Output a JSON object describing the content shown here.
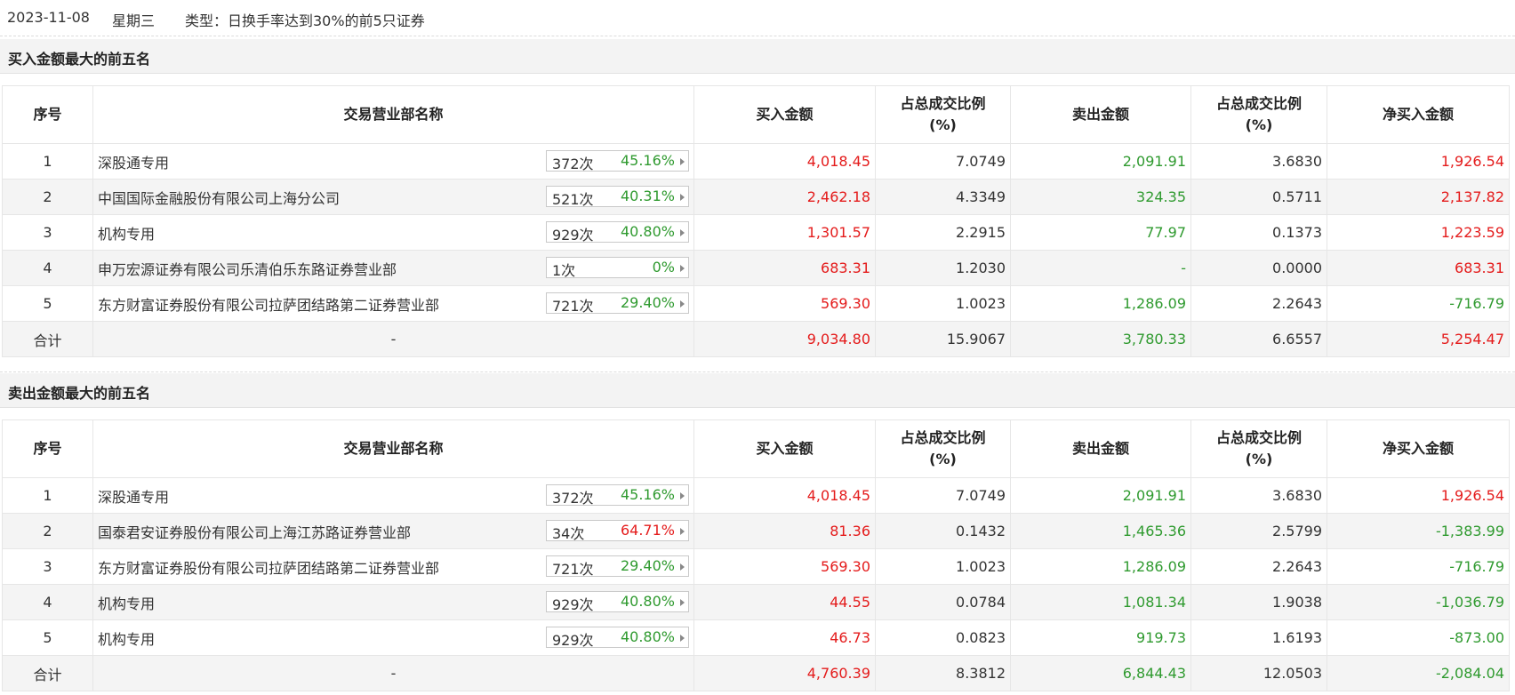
{
  "header": {
    "date": "2023-11-08",
    "weekday": "星期三",
    "type_label": "类型：日换手率达到30%的前5只证券"
  },
  "columns": {
    "seq": "序号",
    "name": "交易营业部名称",
    "buy": "买入金额",
    "buy_ratio_line1": "占总成交比例",
    "buy_ratio_line2": "(%)",
    "sell": "卖出金额",
    "sell_ratio_line1": "占总成交比例",
    "sell_ratio_line2": "(%)",
    "net": "净买入金额"
  },
  "buy_section": {
    "title": "买入金额最大的前五名",
    "rows": [
      {
        "seq": "1",
        "name": "深股通专用",
        "count": "372次",
        "rate": "45.16%",
        "rate_color": "green",
        "buy": "4,018.45",
        "buy_ratio": "7.0749",
        "sell": "2,091.91",
        "sell_ratio": "3.6830",
        "net": "1,926.54",
        "net_color": "red"
      },
      {
        "seq": "2",
        "name": "中国国际金融股份有限公司上海分公司",
        "count": "521次",
        "rate": "40.31%",
        "rate_color": "green",
        "buy": "2,462.18",
        "buy_ratio": "4.3349",
        "sell": "324.35",
        "sell_ratio": "0.5711",
        "net": "2,137.82",
        "net_color": "red"
      },
      {
        "seq": "3",
        "name": "机构专用",
        "count": "929次",
        "rate": "40.80%",
        "rate_color": "green",
        "buy": "1,301.57",
        "buy_ratio": "2.2915",
        "sell": "77.97",
        "sell_ratio": "0.1373",
        "net": "1,223.59",
        "net_color": "red"
      },
      {
        "seq": "4",
        "name": "申万宏源证券有限公司乐清伯乐东路证券营业部",
        "count": "1次",
        "rate": "0%",
        "rate_color": "green",
        "buy": "683.31",
        "buy_ratio": "1.2030",
        "sell": "-",
        "sell_ratio": "0.0000",
        "net": "683.31",
        "net_color": "red"
      },
      {
        "seq": "5",
        "name": "东方财富证券股份有限公司拉萨团结路第二证券营业部",
        "count": "721次",
        "rate": "29.40%",
        "rate_color": "green",
        "buy": "569.30",
        "buy_ratio": "1.0023",
        "sell": "1,286.09",
        "sell_ratio": "2.2643",
        "net": "-716.79",
        "net_color": "green"
      }
    ],
    "total": {
      "label": "合计",
      "name": "-",
      "buy": "9,034.80",
      "buy_ratio": "15.9067",
      "sell": "3,780.33",
      "sell_ratio": "6.6557",
      "net": "5,254.47",
      "net_color": "red"
    }
  },
  "sell_section": {
    "title": "卖出金额最大的前五名",
    "rows": [
      {
        "seq": "1",
        "name": "深股通专用",
        "count": "372次",
        "rate": "45.16%",
        "rate_color": "green",
        "buy": "4,018.45",
        "buy_ratio": "7.0749",
        "sell": "2,091.91",
        "sell_ratio": "3.6830",
        "net": "1,926.54",
        "net_color": "red"
      },
      {
        "seq": "2",
        "name": "国泰君安证券股份有限公司上海江苏路证券营业部",
        "count": "34次",
        "rate": "64.71%",
        "rate_color": "red",
        "buy": "81.36",
        "buy_ratio": "0.1432",
        "sell": "1,465.36",
        "sell_ratio": "2.5799",
        "net": "-1,383.99",
        "net_color": "green"
      },
      {
        "seq": "3",
        "name": "东方财富证券股份有限公司拉萨团结路第二证券营业部",
        "count": "721次",
        "rate": "29.40%",
        "rate_color": "green",
        "buy": "569.30",
        "buy_ratio": "1.0023",
        "sell": "1,286.09",
        "sell_ratio": "2.2643",
        "net": "-716.79",
        "net_color": "green"
      },
      {
        "seq": "4",
        "name": "机构专用",
        "count": "929次",
        "rate": "40.80%",
        "rate_color": "green",
        "buy": "44.55",
        "buy_ratio": "0.0784",
        "sell": "1,081.34",
        "sell_ratio": "1.9038",
        "net": "-1,036.79",
        "net_color": "green"
      },
      {
        "seq": "5",
        "name": "机构专用",
        "count": "929次",
        "rate": "40.80%",
        "rate_color": "green",
        "buy": "46.73",
        "buy_ratio": "0.0823",
        "sell": "919.73",
        "sell_ratio": "1.6193",
        "net": "-873.00",
        "net_color": "green"
      }
    ],
    "total": {
      "label": "合计",
      "name": "-",
      "buy": "4,760.39",
      "buy_ratio": "8.3812",
      "sell": "6,844.43",
      "sell_ratio": "12.0503",
      "net": "-2,084.04",
      "net_color": "green"
    }
  },
  "colors": {
    "red": "#e41b1b",
    "green": "#2f9a2f"
  },
  "icons": {
    "row_expand": "caret-right-icon"
  }
}
